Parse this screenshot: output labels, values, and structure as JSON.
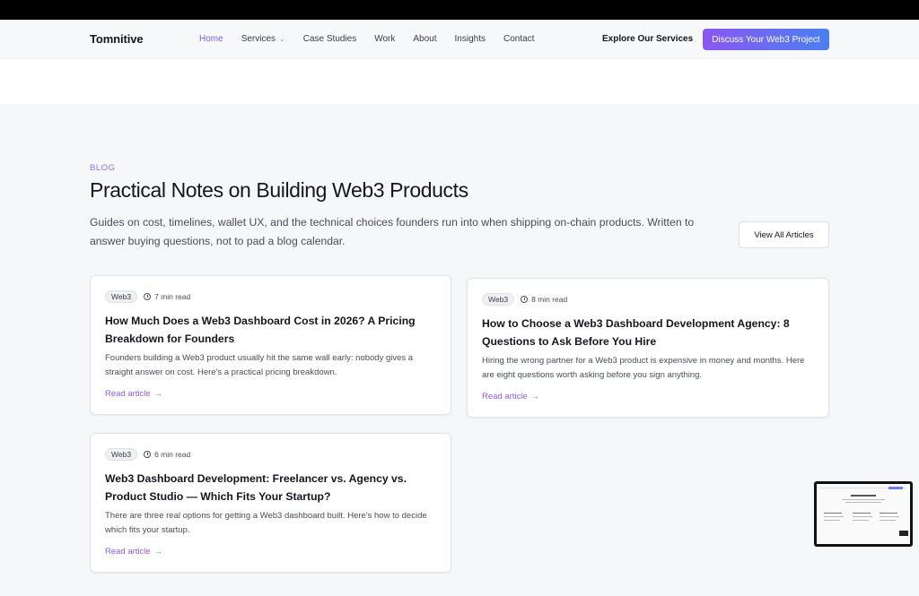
{
  "nav": {
    "brand": "Tomnitive",
    "items": [
      {
        "label": "Home",
        "active": true
      },
      {
        "label": "Services",
        "has_dropdown": true
      },
      {
        "label": "Case Studies"
      },
      {
        "label": "Work"
      },
      {
        "label": "About"
      },
      {
        "label": "Insights"
      },
      {
        "label": "Contact"
      }
    ],
    "explore_label": "Explore Our Services",
    "cta_label": "Discuss Your Web3 Project"
  },
  "blog": {
    "eyebrow": "BLOG",
    "heading": "Practical Notes on Building Web3 Products",
    "subtext": "Guides on cost, timelines, wallet UX, and the technical choices founders run into when shipping on-chain products. Written to answer buying questions, not to pad a blog calendar.",
    "view_all_label": "View All Articles",
    "articles": [
      {
        "tag": "Web3",
        "read_time": "7 min read",
        "title": "How Much Does a Web3 Dashboard Cost in 2026? A Pricing Breakdown for Founders",
        "excerpt": "Founders building a Web3 product usually hit the same wall early: nobody gives a straight answer on cost. Here's a practical pricing breakdown.",
        "link_label": "Read article"
      },
      {
        "tag": "Web3",
        "read_time": "8 min read",
        "title": "How to Choose a Web3 Dashboard Development Agency: 8 Questions to Ask Before You Hire",
        "excerpt": "Hiring the wrong partner for a Web3 product is expensive in money and months. Here are eight questions worth asking before you sign anything.",
        "link_label": "Read article"
      },
      {
        "tag": "Web3",
        "read_time": "6 min read",
        "title": "Web3 Dashboard Development: Freelancer vs. Agency vs. Product Studio — Which Fits Your Startup?",
        "excerpt": "There are three real options for getting a Web3 dashboard built. Here's how to decide which fits your startup.",
        "link_label": "Read article"
      }
    ]
  },
  "colors": {
    "accent": "#7a5cf0",
    "cta_gradient_start": "#8a57f2",
    "cta_gradient_end": "#4b7ff0",
    "background": "#f6f7f9"
  },
  "icons": {
    "dropdown": "chevron-down-icon",
    "clock": "clock-icon",
    "arrow": "arrow-right-icon"
  }
}
